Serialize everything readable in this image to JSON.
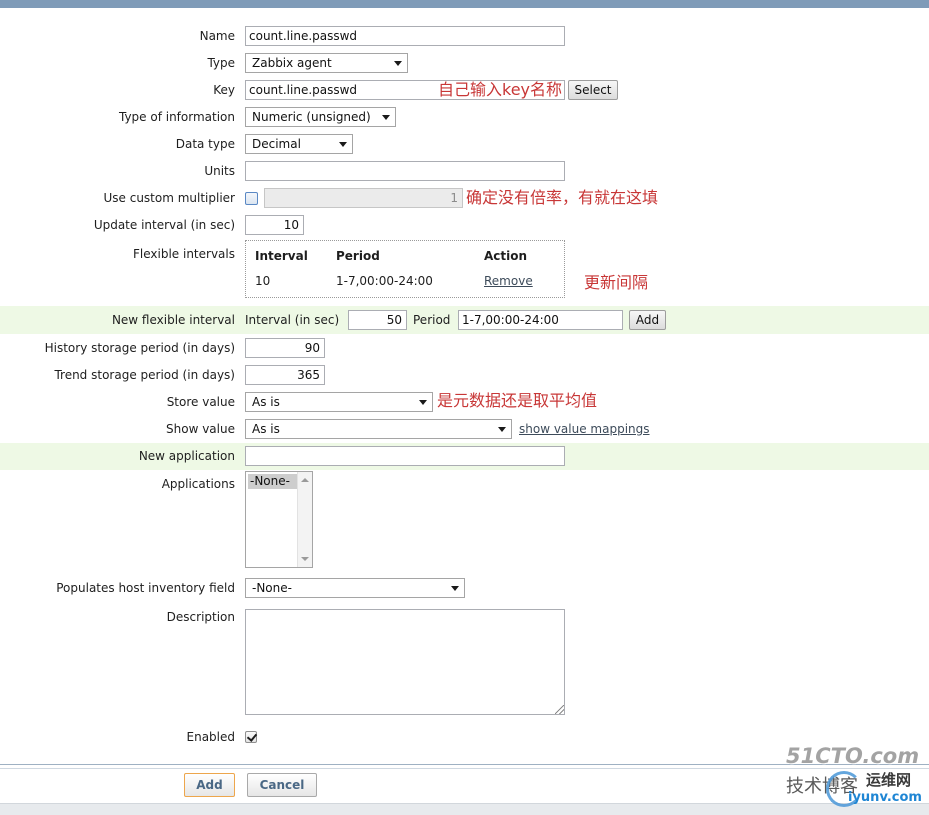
{
  "colors": {
    "header_bar": "#7f9bb8",
    "highlight_band": "#eef9e5",
    "annotation": "#c83737",
    "primary_button_border": "#eda64c"
  },
  "form": {
    "name": {
      "label": "Name",
      "value": "count.line.passwd"
    },
    "type": {
      "label": "Type",
      "value": "Zabbix agent"
    },
    "key": {
      "label": "Key",
      "value": "count.line.passwd",
      "select_label": "Select"
    },
    "type_of_information": {
      "label": "Type of information",
      "value": "Numeric (unsigned)"
    },
    "data_type": {
      "label": "Data type",
      "value": "Decimal"
    },
    "units": {
      "label": "Units",
      "value": ""
    },
    "custom_multiplier": {
      "label": "Use custom multiplier",
      "checked": false,
      "value": "1"
    },
    "update_interval": {
      "label": "Update interval (in sec)",
      "value": "10"
    },
    "flexible_intervals": {
      "label": "Flexible intervals",
      "columns": {
        "interval": "Interval",
        "period": "Period",
        "action": "Action"
      },
      "rows": [
        {
          "interval": "10",
          "period": "1-7,00:00-24:00",
          "action": "Remove"
        }
      ]
    },
    "new_flexible_interval": {
      "label": "New flexible interval",
      "interval_label": "Interval (in sec)",
      "interval_value": "50",
      "period_label": "Period",
      "period_value": "1-7,00:00-24:00",
      "add_label": "Add"
    },
    "history": {
      "label": "History storage period (in days)",
      "value": "90"
    },
    "trends": {
      "label": "Trend storage period (in days)",
      "value": "365"
    },
    "store_value": {
      "label": "Store value",
      "value": "As is"
    },
    "show_value": {
      "label": "Show value",
      "value": "As is",
      "mappings_link": "show value mappings"
    },
    "new_application": {
      "label": "New application",
      "value": ""
    },
    "applications": {
      "label": "Applications",
      "options": [
        {
          "label": "-None-",
          "selected": true
        }
      ]
    },
    "inventory_field": {
      "label": "Populates host inventory field",
      "value": "-None-"
    },
    "description": {
      "label": "Description",
      "value": ""
    },
    "enabled": {
      "label": "Enabled",
      "checked": true
    }
  },
  "annotations": {
    "key_hint": "自己输入key名称",
    "multiplier_hint": "确定没有倍率，有就在这填",
    "flexible_hint": "更新间隔",
    "store_value_hint": "是元数据还是取平均值"
  },
  "footer": {
    "add_label": "Add",
    "cancel_label": "Cancel"
  },
  "watermark": {
    "brand": "51CTO.com",
    "blog": "技术博客",
    "site_cn": "运维网",
    "site": "iyunv.com"
  }
}
